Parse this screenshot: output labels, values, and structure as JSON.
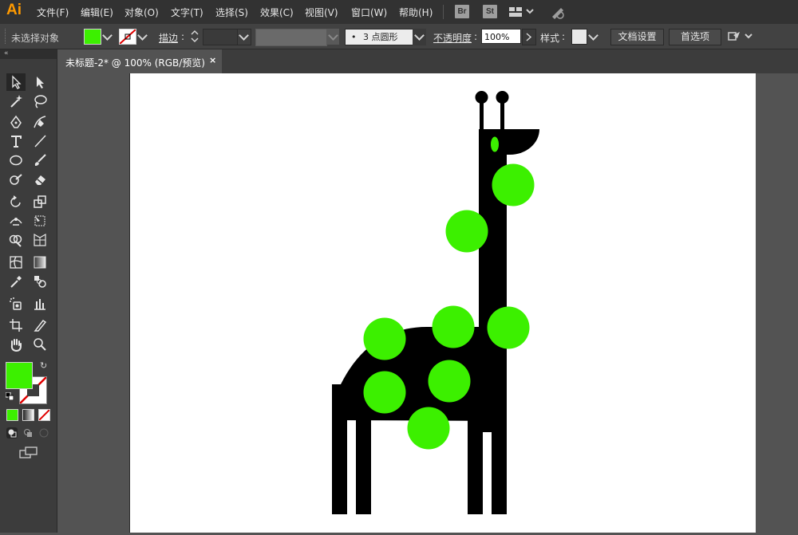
{
  "app": {
    "logo": "Ai"
  },
  "menu": [
    {
      "id": "file",
      "label": "文件(F)"
    },
    {
      "id": "edit",
      "label": "编辑(E)"
    },
    {
      "id": "object",
      "label": "对象(O)"
    },
    {
      "id": "type",
      "label": "文字(T)"
    },
    {
      "id": "select",
      "label": "选择(S)"
    },
    {
      "id": "effect",
      "label": "效果(C)"
    },
    {
      "id": "view",
      "label": "视图(V)"
    },
    {
      "id": "window",
      "label": "窗口(W)"
    },
    {
      "id": "help",
      "label": "帮助(H)"
    }
  ],
  "bridge": {
    "br": "Br",
    "st": "St"
  },
  "control_bar": {
    "selection_status": "未选择对象",
    "fill_color": "#3cf000",
    "stroke_label": "描边",
    "brush_label": "3 点圆形",
    "opacity_label": "不透明度",
    "opacity_value": "100%",
    "style_label": "样式",
    "doc_setup_button": "文档设置",
    "preferences_button": "首选项",
    "colon": ":"
  },
  "document_tab": {
    "title": "未标题-2* @ 100% (RGB/预览)",
    "close": "×"
  },
  "tools": {
    "fill_color": "#3cf000",
    "stroke": "none"
  },
  "artwork": {
    "shape_color": "#000000",
    "spot_color": "#3cf000",
    "description_spots": 9
  }
}
